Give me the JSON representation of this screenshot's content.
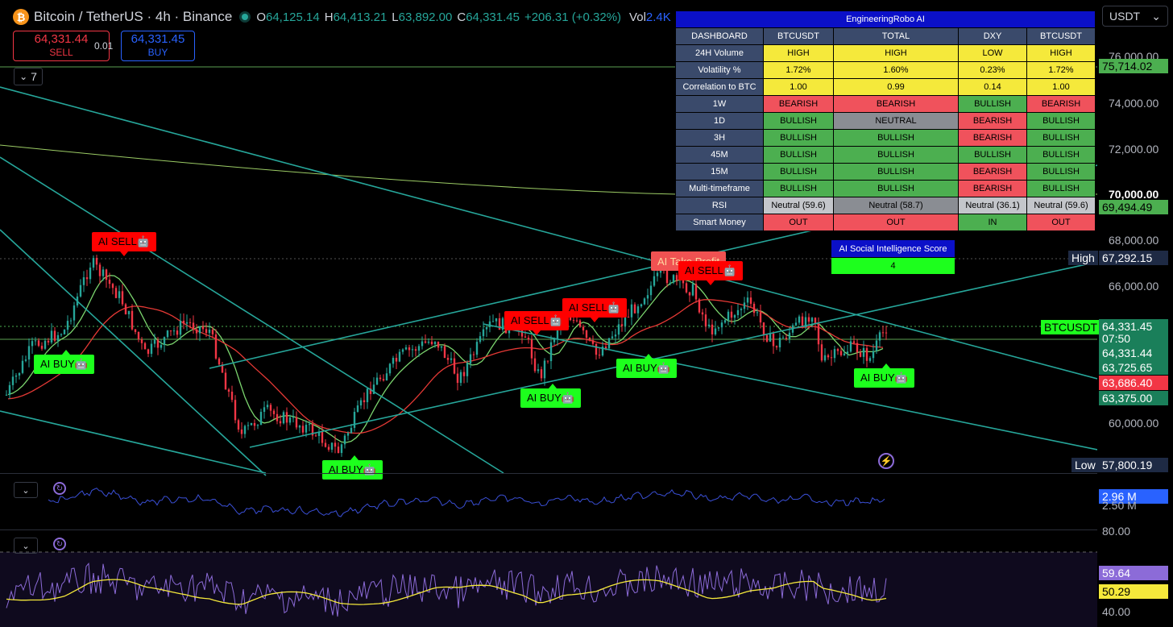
{
  "header": {
    "logo_glyph": "₿",
    "symbol_title": "Bitcoin / TetherUS · 4h · Binance",
    "ohlc": [
      {
        "key": "O",
        "value": "64,125.14"
      },
      {
        "key": "H",
        "value": "64,413.21"
      },
      {
        "key": "L",
        "value": "63,892.00"
      },
      {
        "key": "C",
        "value": "64,331.45"
      }
    ],
    "change": "+206.31 (+0.32%)",
    "vol_label": "Vol",
    "vol_value": "2.4K"
  },
  "trade": {
    "sell_price": "64,331.44",
    "sell_label": "SELL",
    "spread": "0.01",
    "buy_price": "64,331.45",
    "buy_label": "BUY"
  },
  "indicators_toggle": {
    "chevron": "⌄",
    "count": "7"
  },
  "currency_select": {
    "value": "USDT",
    "chevron": "⌄"
  },
  "dashboard": {
    "title": "EngineeringRobo AI",
    "header": [
      "DASHBOARD",
      "BTCUSDT",
      "TOTAL",
      "DXY",
      "BTCUSDT"
    ],
    "rows": [
      {
        "label": "24H Volume",
        "cells": [
          [
            "HIGH",
            "yellow"
          ],
          [
            "HIGH",
            "yellow"
          ],
          [
            "LOW",
            "yellow"
          ],
          [
            "HIGH",
            "yellow"
          ]
        ]
      },
      {
        "label": "Volatility %",
        "cells": [
          [
            "1.72%",
            "yellow"
          ],
          [
            "1.60%",
            "yellow"
          ],
          [
            "0.23%",
            "yellow"
          ],
          [
            "1.72%",
            "yellow"
          ]
        ]
      },
      {
        "label": "Correlation to BTC",
        "cells": [
          [
            "1.00",
            "yellow"
          ],
          [
            "0.99",
            "yellow"
          ],
          [
            "0.14",
            "yellow"
          ],
          [
            "1.00",
            "yellow"
          ]
        ]
      },
      {
        "label": "1W",
        "cells": [
          [
            "BEARISH",
            "red"
          ],
          [
            "BEARISH",
            "red"
          ],
          [
            "BULLISH",
            "green"
          ],
          [
            "BEARISH",
            "red"
          ]
        ]
      },
      {
        "label": "1D",
        "cells": [
          [
            "BULLISH",
            "green"
          ],
          [
            "NEUTRAL",
            "grey"
          ],
          [
            "BEARISH",
            "red"
          ],
          [
            "BULLISH",
            "green"
          ]
        ]
      },
      {
        "label": "3H",
        "cells": [
          [
            "BULLISH",
            "green"
          ],
          [
            "BULLISH",
            "green"
          ],
          [
            "BEARISH",
            "red"
          ],
          [
            "BULLISH",
            "green"
          ]
        ]
      },
      {
        "label": "45M",
        "cells": [
          [
            "BULLISH",
            "green"
          ],
          [
            "BULLISH",
            "green"
          ],
          [
            "BULLISH",
            "green"
          ],
          [
            "BULLISH",
            "green"
          ]
        ]
      },
      {
        "label": "15M",
        "cells": [
          [
            "BULLISH",
            "green"
          ],
          [
            "BULLISH",
            "green"
          ],
          [
            "BEARISH",
            "red"
          ],
          [
            "BULLISH",
            "green"
          ]
        ]
      },
      {
        "label": "Multi-timeframe",
        "cells": [
          [
            "BULLISH",
            "green"
          ],
          [
            "BULLISH",
            "green"
          ],
          [
            "BEARISH",
            "red"
          ],
          [
            "BULLISH",
            "green"
          ]
        ]
      },
      {
        "label": "RSI",
        "cells": [
          [
            "Neutral (59.6)",
            "lightgrey"
          ],
          [
            "Neutral (58.7)",
            "grey"
          ],
          [
            "Neutral (36.1)",
            "lightgrey"
          ],
          [
            "Neutral (59.6)",
            "lightgrey"
          ]
        ]
      },
      {
        "label": "Smart Money",
        "cells": [
          [
            "OUT",
            "red"
          ],
          [
            "OUT",
            "red"
          ],
          [
            "IN",
            "green"
          ],
          [
            "OUT",
            "red"
          ]
        ]
      }
    ],
    "social_title": "AI Social Intelligence Score",
    "social_value": "4"
  },
  "signals": [
    {
      "text": "AI SELL🤖",
      "type": "sell"
    },
    {
      "text": "AI BUY🤖",
      "type": "buy"
    },
    {
      "text": "AI BUY🤖",
      "type": "buy"
    },
    {
      "text": "AI SELL🤖",
      "type": "sell"
    },
    {
      "text": "AI BUY🤖",
      "type": "buy"
    },
    {
      "text": "AI SELL🤖",
      "type": "sell"
    },
    {
      "text": "AI BUY🤖",
      "type": "buy"
    },
    {
      "text": "AI Take Profit",
      "type": "tp"
    },
    {
      "text": "AI SELL🤖",
      "type": "sell"
    },
    {
      "text": "AI BUY🤖",
      "type": "buy"
    }
  ],
  "price_axis": {
    "ticks": [
      "76,000.00",
      "74,000.00",
      "72,000.00",
      "70,000.00",
      "68,000.00",
      "66,000.00",
      "60,000.00"
    ],
    "labels": {
      "ma_long": "75,714.02",
      "ma_mid": "69,494.49",
      "high_tag": "High",
      "high": "67,292.15",
      "symbol_tag": "BTCUSDT",
      "last": "64,331.45",
      "countdown": "07:50",
      "bid": "64,331.44",
      "ma1": "63,725.65",
      "ma2": "63,686.40",
      "ma3": "63,375.00",
      "low_tag": "Low",
      "low": "57,800.19"
    }
  },
  "volume_pane": {
    "value": "2.96 M",
    "tick": "2.50 M"
  },
  "rsi_pane": {
    "top": "80.00",
    "rsi": "59.64",
    "rsi_ma": "50.29",
    "bottom": "40.00"
  },
  "colors": {
    "bull": "#26a69a",
    "bear": "#f23645",
    "trendline": "#26a69a",
    "ma_fast": "#7bd56e",
    "ma_slow": "#e53935",
    "volume_line": "#3a4fd6",
    "rsi_line": "#8c6bd8",
    "rsi_ma": "#f5e93b"
  }
}
